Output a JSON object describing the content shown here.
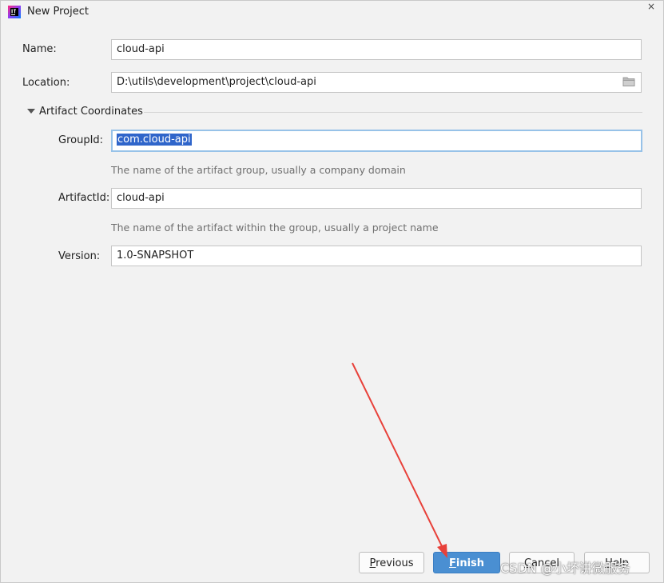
{
  "window": {
    "title": "New Project",
    "close_glyph": "×"
  },
  "fields": {
    "name": {
      "label": "Name:",
      "value": "cloud-api"
    },
    "location": {
      "label": "Location:",
      "value": "D:\\utils\\development\\project\\cloud-api",
      "icon": "folder-icon"
    },
    "group_id": {
      "label": "GroupId:",
      "value": "com.cloud-api",
      "hint": "The name of the artifact group, usually a company domain"
    },
    "artifact_id": {
      "label": "ArtifactId:",
      "value": "cloud-api",
      "hint": "The name of the artifact within the group, usually a project name"
    },
    "version": {
      "label": "Version:",
      "value": "1.0-SNAPSHOT"
    }
  },
  "section": {
    "title": "Artifact Coordinates",
    "expanded": true
  },
  "buttons": {
    "previous": {
      "mnemonic": "P",
      "rest": "revious"
    },
    "finish": {
      "mnemonic": "F",
      "rest": "inish"
    },
    "cancel": {
      "mnemonic": "C",
      "rest": "ancel"
    },
    "help": {
      "mnemonic": "H",
      "rest": "elp"
    }
  },
  "watermark": "CSDN @小坏讲微服务",
  "colors": {
    "primary_button": "#4a8fd2",
    "selection": "#2f65ca",
    "focus_border": "#97c2e8",
    "annotation_arrow": "#e8413a"
  }
}
